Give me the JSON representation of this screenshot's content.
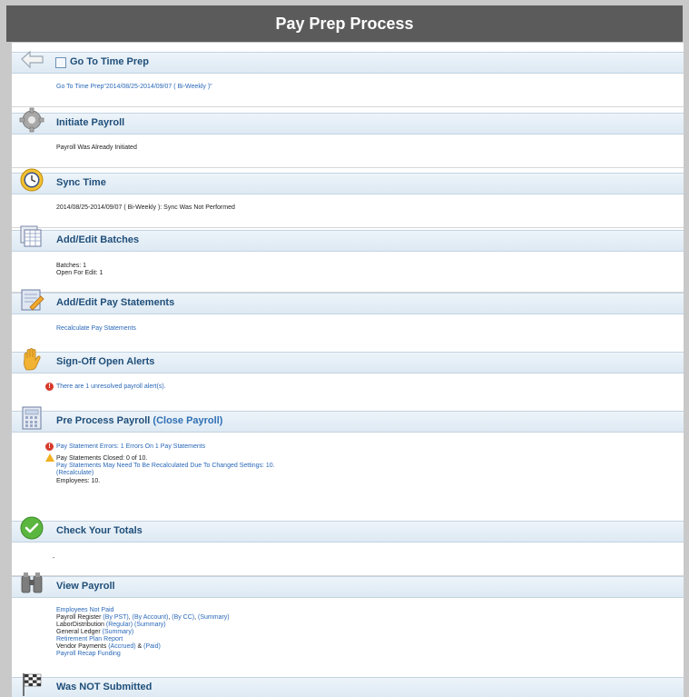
{
  "title": "Pay Prep Process",
  "sections": {
    "s0": {
      "title": "Go To Time Prep",
      "link": "Go To Time Prep\"2014/08/25-2014/09/07 ( Bi-Weekly )\""
    },
    "s1": {
      "title": "Initiate Payroll",
      "line": "Payroll Was Already Initiated"
    },
    "s2": {
      "title": "Sync Time",
      "line": "2014/08/25-2014/09/07 ( Bi-Weekly ): Sync Was Not Performed"
    },
    "s3": {
      "title": "Add/Edit Batches",
      "line1": "Batches: 1",
      "line2": "Open For Edit: 1"
    },
    "s4": {
      "title": "Add/Edit Pay Statements",
      "link": "Recalculate Pay Statements"
    },
    "s5": {
      "title": "Sign-Off Open Alerts",
      "link": "There are 1 unresolved payroll alert(s)."
    },
    "s6": {
      "title": "Pre Process Payroll",
      "title_link": "(Close Payroll)",
      "err_link": "Pay Statement Errors: 1 Errors On 1 Pay Statements",
      "closed": "Pay Statements Closed: 0 of 10.",
      "recalc_note": "Pay Statements May Need To Be Recalculated Due To Changed Settings: 10.",
      "recalc_link": "(Recalculate)",
      "employees": "Employees: 10."
    },
    "s7": {
      "title": "Check Your Totals",
      "line": "-"
    },
    "s8": {
      "title": "View Payroll",
      "not_paid": "Employees Not Paid",
      "register_label": "Payroll Register",
      "register_pst": "(By PST)",
      "register_account": "(By Account)",
      "register_cc": "(By CC)",
      "register_summary": "(Summary)",
      "labor_label": "LaborDistribution",
      "labor_regular": "(Regular)",
      "labor_summary": "(Summary)",
      "gl_label": "General Ledger",
      "gl_summary": "(Summary)",
      "retirement": "Retirement Plan Report",
      "vendor_label": "Vendor Payments",
      "vendor_accrued": "(Accrued)",
      "vendor_amp": "&",
      "vendor_paid": "(Paid)",
      "recap": "Payroll Recap Funding"
    },
    "s9": {
      "title": "Was NOT Submitted"
    }
  },
  "icons": {
    "s0": "back-arrow-icon",
    "s1": "gear-icon",
    "s2": "clock-icon",
    "s3": "batches-icon",
    "s4": "edit-document-icon",
    "s5": "hand-icon",
    "s6": "calculator-icon",
    "s7": "check-circle-icon",
    "s8": "binoculars-icon",
    "s9": "checkered-flag-icon"
  },
  "colors": {
    "titlebar": "#5b5b5b",
    "section_header": "#e4eef6",
    "link": "#2a68b8",
    "heading": "#1f4e79",
    "error": "#d63a2a",
    "warning": "#f0b020",
    "success": "#4cae3a"
  }
}
